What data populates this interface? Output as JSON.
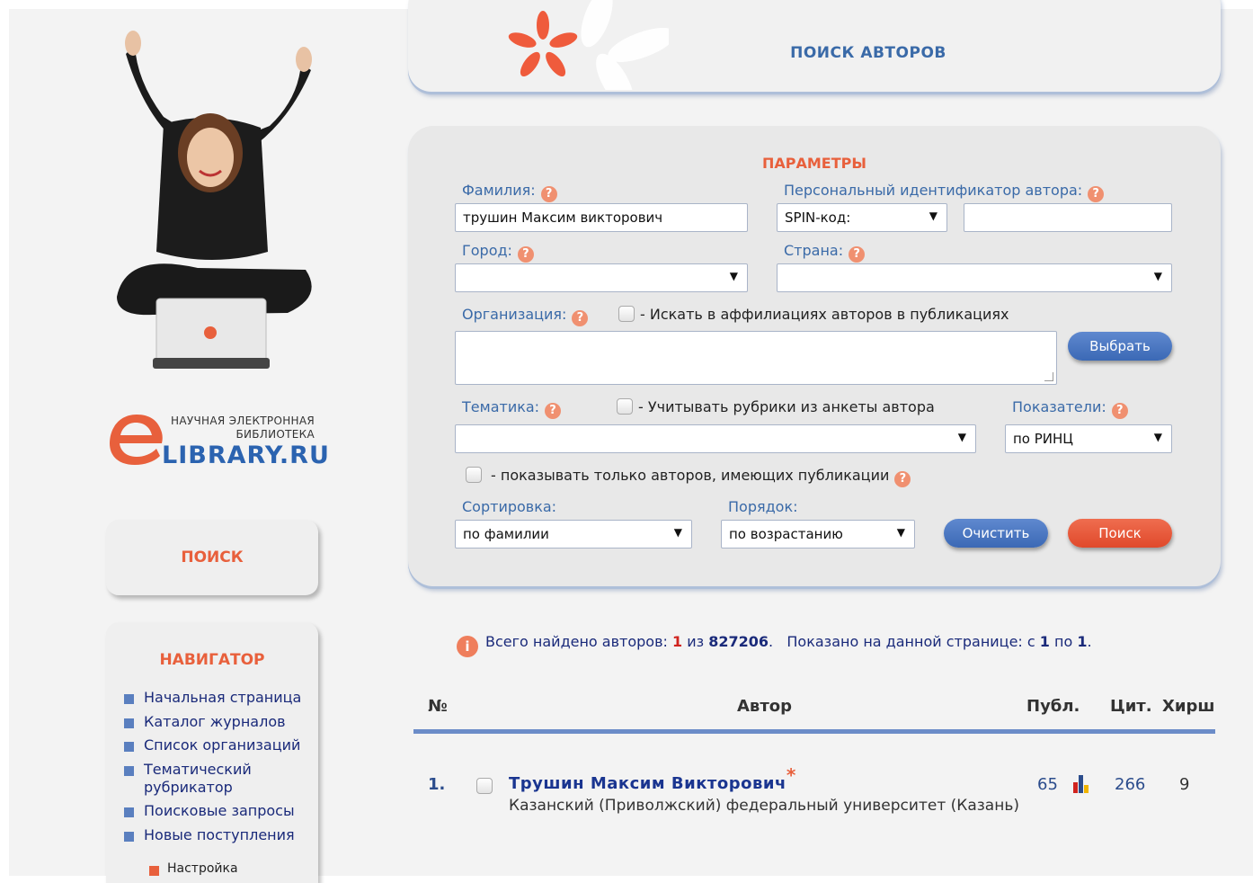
{
  "header": {
    "title": "ПОИСК АВТОРОВ"
  },
  "logo": {
    "line1": "НАУЧНАЯ ЭЛЕКТРОННАЯ",
    "line2": "БИБЛИОТЕКА",
    "brand": "LIBRARY.RU"
  },
  "sidebar": {
    "search_title": "ПОИСК",
    "navigator_title": "НАВИГАТОР",
    "nav_items": [
      {
        "label": "Начальная страница"
      },
      {
        "label": "Каталог журналов"
      },
      {
        "label": "Список организаций"
      },
      {
        "label": "Тематический рубрикатор"
      },
      {
        "label": "Поисковые запросы"
      },
      {
        "label": "Новые поступления"
      }
    ],
    "nav_sub": "Настройка"
  },
  "params": {
    "title": "ПАРАМЕТРЫ",
    "surname_label": "Фамилия:",
    "surname_value": "трушин Максим викторович",
    "id_label": "Персональный идентификатор автора:",
    "id_type_value": "SPIN-код:",
    "id_value": "",
    "city_label": "Город:",
    "city_value": "",
    "country_label": "Страна:",
    "country_value": "",
    "org_label": "Организация:",
    "org_checkbox_label": "- Искать в аффилиациях авторов в публикациях",
    "org_value": "",
    "choose_button": "Выбрать",
    "topic_label": "Тематика:",
    "topic_checkbox_label": "- Учитывать рубрики из анкеты автора",
    "topic_value": "",
    "indicators_label": "Показатели:",
    "indicators_value": "по РИНЦ",
    "only_with_pubs_label": "- показывать только авторов, имеющих публикации",
    "sort_label": "Сортировка:",
    "sort_value": "по фамилии",
    "order_label": "Порядок:",
    "order_value": "по возрастанию",
    "clear_button": "Очистить",
    "search_button": "Поиск"
  },
  "results": {
    "found_prefix": "Всего найдено авторов:",
    "found_count": "1",
    "found_of": "из",
    "found_total": "827206",
    "shown_prefix": "Показано на данной странице: с",
    "shown_from": "1",
    "shown_to_word": "по",
    "shown_to": "1",
    "columns": {
      "num": "№",
      "author": "Автор",
      "pubs": "Публ.",
      "cites": "Цит.",
      "hirsch": "Хирш"
    },
    "rows": [
      {
        "num": "1.",
        "name": "Трушин Максим Викторович",
        "org": "Казанский (Приволжский) федеральный университет (Казань)",
        "pubs": "65",
        "cites": "266",
        "hirsch": "9"
      }
    ]
  },
  "colors": {
    "accent_orange": "#e8603c",
    "link_blue": "#3a6aa8",
    "navy": "#1a2a7a",
    "rule_blue": "#6b8cc8"
  }
}
